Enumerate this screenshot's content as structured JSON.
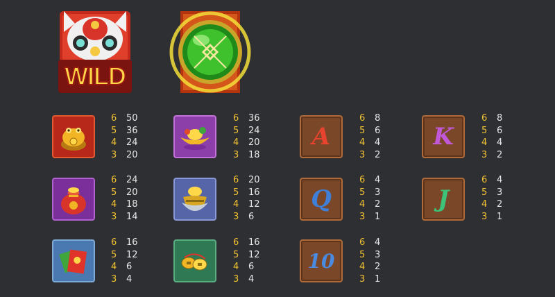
{
  "special_symbols": {
    "wild": {
      "icon": "lion-dance-head-icon",
      "label": "WILD"
    },
    "scatter": {
      "icon": "jade-orb-icon"
    }
  },
  "colors": {
    "count": "#f2c230",
    "value": "#e6e6e6",
    "background": "#2e2f33"
  },
  "paytable": [
    {
      "name": "golden-toad",
      "icon": "golden-toad-icon",
      "rows": [
        {
          "count": "6",
          "value": "50"
        },
        {
          "count": "5",
          "value": "36"
        },
        {
          "count": "4",
          "value": "24"
        },
        {
          "count": "3",
          "value": "20"
        }
      ]
    },
    {
      "name": "gold-ingot-boat",
      "icon": "gold-ingot-boat-icon",
      "rows": [
        {
          "count": "6",
          "value": "36"
        },
        {
          "count": "5",
          "value": "24"
        },
        {
          "count": "4",
          "value": "20"
        },
        {
          "count": "3",
          "value": "18"
        }
      ]
    },
    {
      "name": "letter-a",
      "label": "A",
      "icon": "letter-a-icon",
      "rows": [
        {
          "count": "6",
          "value": "8"
        },
        {
          "count": "5",
          "value": "6"
        },
        {
          "count": "4",
          "value": "4"
        },
        {
          "count": "3",
          "value": "2"
        }
      ]
    },
    {
      "name": "letter-k",
      "label": "K",
      "icon": "letter-k-icon",
      "rows": [
        {
          "count": "6",
          "value": "8"
        },
        {
          "count": "5",
          "value": "6"
        },
        {
          "count": "4",
          "value": "4"
        },
        {
          "count": "3",
          "value": "2"
        }
      ]
    },
    {
      "name": "lucky-bag",
      "icon": "lucky-bag-icon",
      "rows": [
        {
          "count": "6",
          "value": "24"
        },
        {
          "count": "5",
          "value": "20"
        },
        {
          "count": "4",
          "value": "18"
        },
        {
          "count": "3",
          "value": "14"
        }
      ]
    },
    {
      "name": "gold-ingot-bowl",
      "icon": "gold-ingot-bowl-icon",
      "rows": [
        {
          "count": "6",
          "value": "20"
        },
        {
          "count": "5",
          "value": "16"
        },
        {
          "count": "4",
          "value": "12"
        },
        {
          "count": "3",
          "value": "6"
        }
      ]
    },
    {
      "name": "letter-q",
      "label": "Q",
      "icon": "letter-q-icon",
      "rows": [
        {
          "count": "6",
          "value": "4"
        },
        {
          "count": "5",
          "value": "3"
        },
        {
          "count": "4",
          "value": "2"
        },
        {
          "count": "3",
          "value": "1"
        }
      ]
    },
    {
      "name": "letter-j",
      "label": "J",
      "icon": "letter-j-icon",
      "rows": [
        {
          "count": "6",
          "value": "4"
        },
        {
          "count": "5",
          "value": "3"
        },
        {
          "count": "4",
          "value": "2"
        },
        {
          "count": "3",
          "value": "1"
        }
      ]
    },
    {
      "name": "red-envelope",
      "icon": "red-envelope-icon",
      "rows": [
        {
          "count": "6",
          "value": "16"
        },
        {
          "count": "5",
          "value": "12"
        },
        {
          "count": "4",
          "value": "6"
        },
        {
          "count": "3",
          "value": "4"
        }
      ]
    },
    {
      "name": "coins",
      "icon": "coins-icon",
      "rows": [
        {
          "count": "6",
          "value": "16"
        },
        {
          "count": "5",
          "value": "12"
        },
        {
          "count": "4",
          "value": "6"
        },
        {
          "count": "3",
          "value": "4"
        }
      ]
    },
    {
      "name": "number-10",
      "label": "10",
      "icon": "number-10-icon",
      "rows": [
        {
          "count": "6",
          "value": "4"
        },
        {
          "count": "5",
          "value": "3"
        },
        {
          "count": "4",
          "value": "2"
        },
        {
          "count": "3",
          "value": "1"
        }
      ]
    }
  ]
}
